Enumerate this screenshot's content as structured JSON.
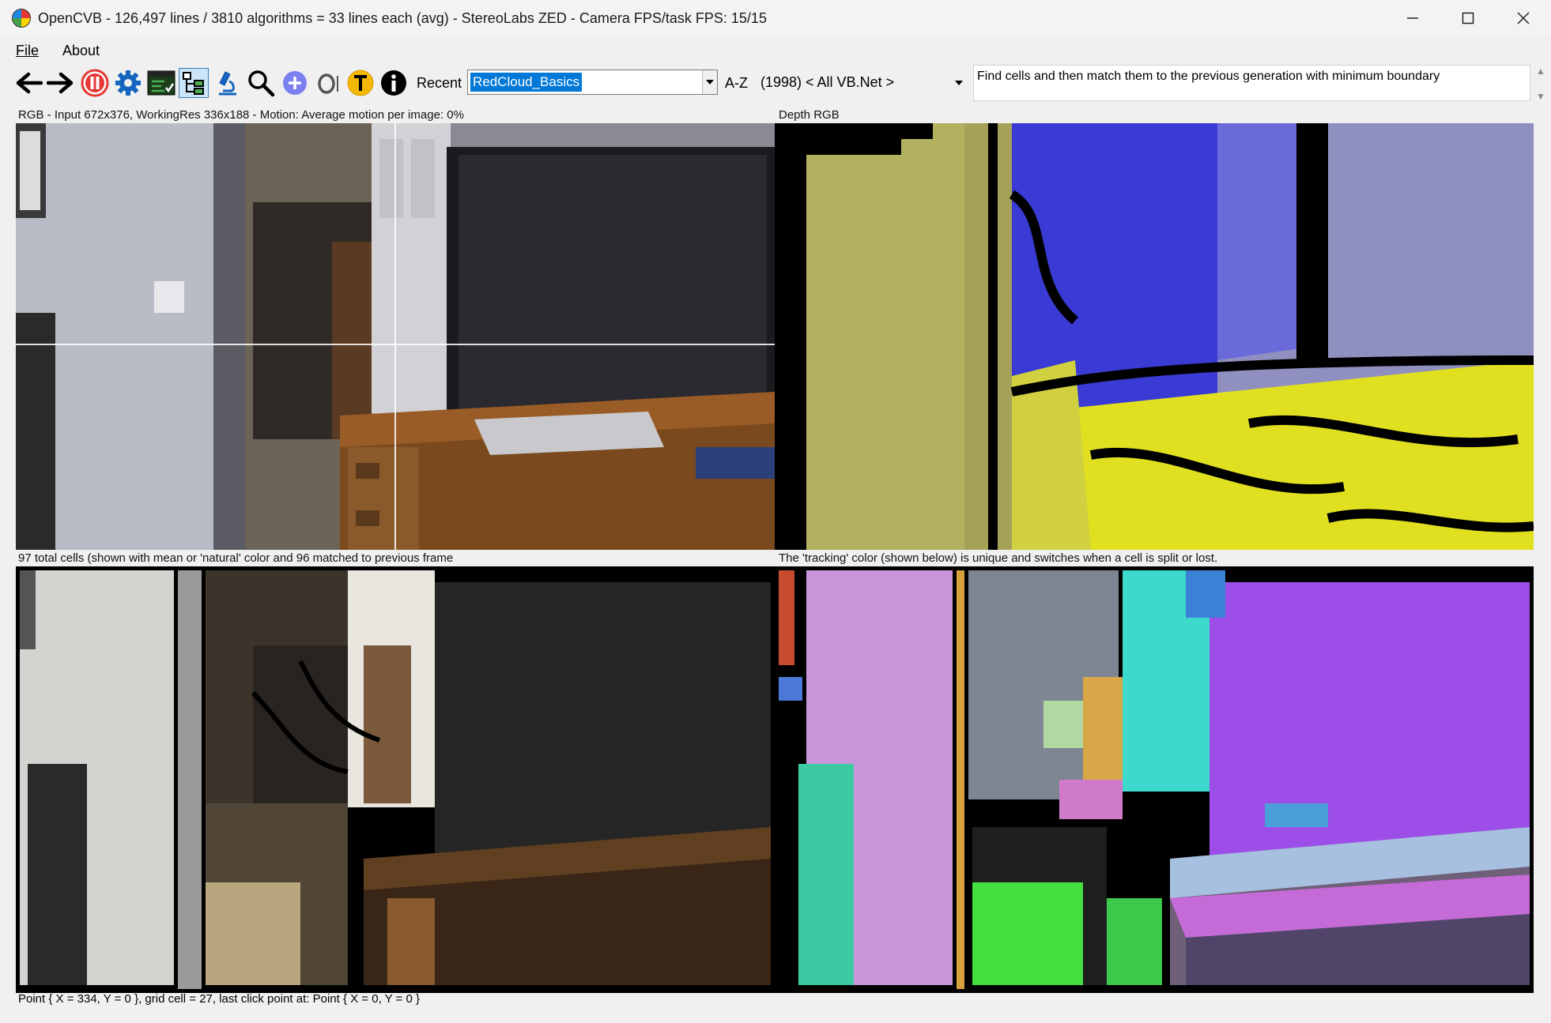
{
  "window": {
    "title": "OpenCVB - 126,497 lines / 3810 algorithms = 33 lines each (avg) - StereoLabs ZED - Camera FPS/task FPS: 15/15"
  },
  "menu": {
    "file": "File",
    "about": "About"
  },
  "toolbar": {
    "icons": [
      "back-arrow-icon",
      "forward-arrow-icon",
      "pause-icon",
      "gear-icon",
      "checklist-icon",
      "tree-icon",
      "microscope-icon",
      "magnifier-icon",
      "plus-icon",
      "o-icon",
      "t-icon",
      "info-icon"
    ],
    "recent_label": "Recent",
    "algorithm_value": "RedCloud_Basics",
    "az_label": "A-Z",
    "group_value": "(1998) < All VB.Net >",
    "description": "Find cells and then match them to the previous generation with minimum boundary"
  },
  "panels": {
    "top_left_caption": "RGB - Input 672x376, WorkingRes 336x188 - Motion:  Average motion per image: 0%",
    "top_right_caption": "Depth RGB",
    "bottom_left_caption": "97 total cells (shown with mean or 'natural' color and 96 matched to previous frame",
    "bottom_right_caption": "The 'tracking' color (shown below) is unique and switches when a cell is split or lost."
  },
  "status": "Point { X = 334, Y = 0 }, grid cell = 27, last click point at: Point { X = 0, Y = 0 }",
  "colors": {
    "accent": "#0078d7",
    "pause": "#e53935",
    "gear": "#1565c0"
  }
}
